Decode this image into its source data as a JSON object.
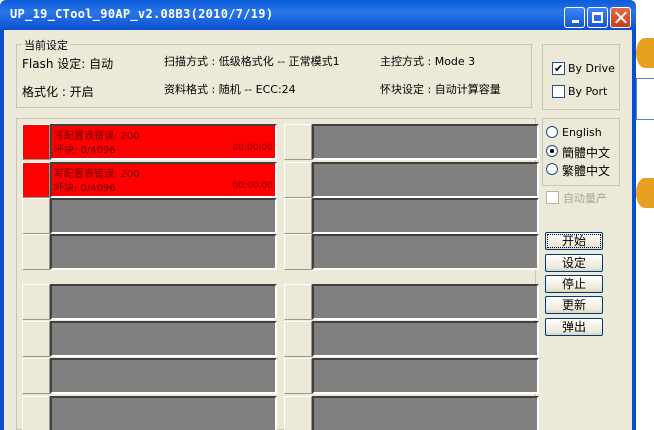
{
  "window": {
    "title": "UP_19_CTool_90AP_v2.08B3(2010/7/19)"
  },
  "settings": {
    "group_label": "当前设定",
    "flash": "Flash 设定: 自动",
    "scan_mode": "扫描方式 : 低级格式化 -- 正常模式1",
    "controller": "主控方式 : Mode 3",
    "format": "格式化 : 开启",
    "data_format": "资料格式 : 随机 -- ECC:24",
    "bad_block": "怀块设定 : 自动计算容量"
  },
  "drive_options": {
    "by_drive": "By Drive",
    "by_drive_checked": true,
    "by_port": "By Port",
    "by_port_checked": false
  },
  "language": {
    "options": [
      "English",
      "簡體中文",
      "繁體中文"
    ],
    "selected": 1
  },
  "auto_mass": {
    "label": "自动量产",
    "checked": false,
    "disabled": true
  },
  "buttons": {
    "start": "开始",
    "settings": "设定",
    "stop": "停止",
    "update": "更新",
    "eject": "弹出"
  },
  "slots": {
    "error": {
      "line1": "写配置表错误: 200",
      "line2": "坏块: 0/4096",
      "time": "00:00:00"
    }
  },
  "colors": {
    "error": "#ff0000",
    "idle": "#808080",
    "title_bar": "#0a5bd9"
  }
}
